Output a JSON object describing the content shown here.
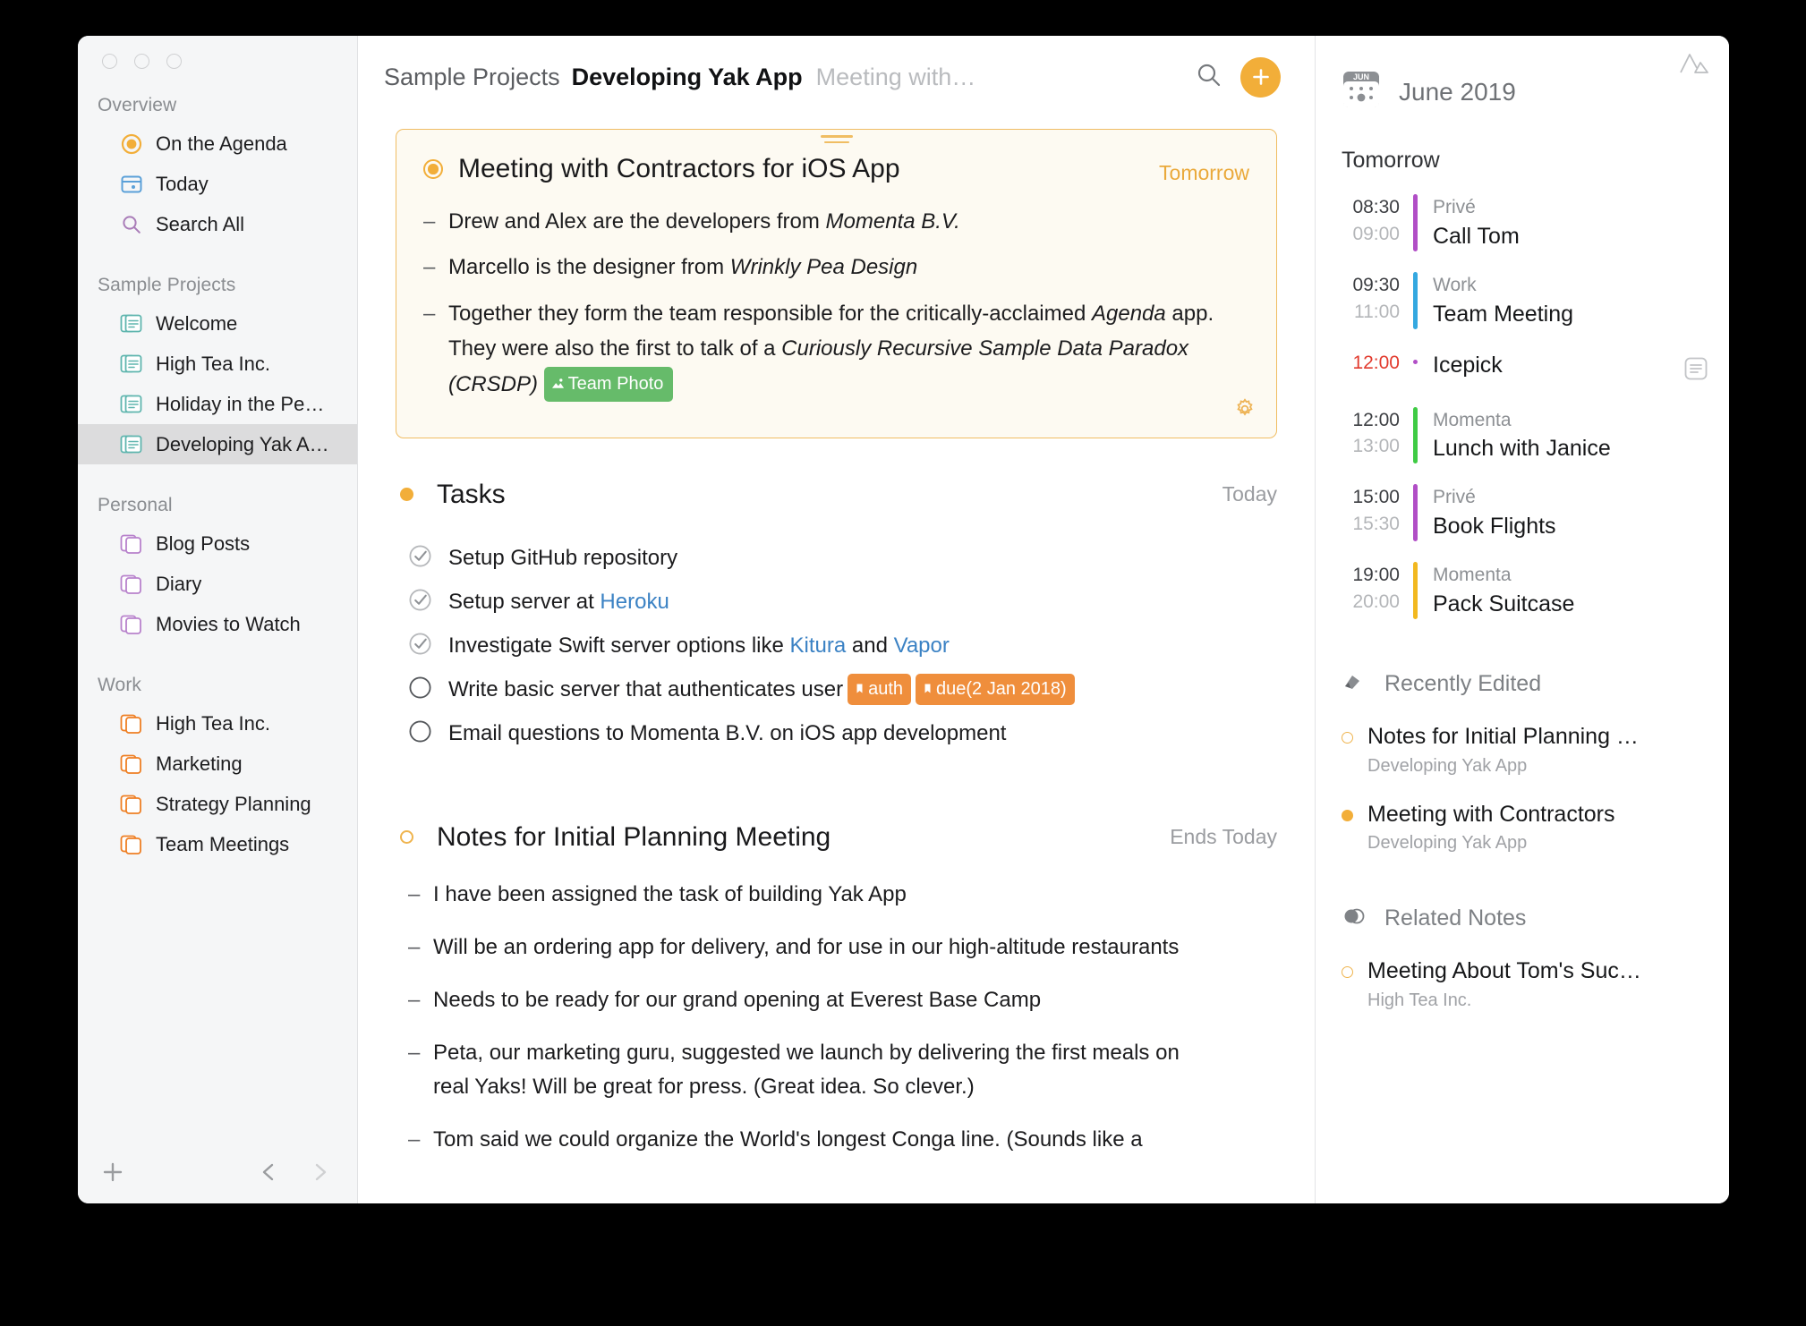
{
  "window": {
    "traffic_lights": [
      "close",
      "minimize",
      "zoom"
    ]
  },
  "sidebar": {
    "groups": [
      {
        "title": "Overview",
        "items": [
          {
            "label": "On the Agenda",
            "icon": "agenda-target-icon",
            "selected": false
          },
          {
            "label": "Today",
            "icon": "today-calendar-icon",
            "selected": false
          },
          {
            "label": "Search All",
            "icon": "search-icon",
            "selected": false
          }
        ]
      },
      {
        "title": "Sample Projects",
        "items": [
          {
            "label": "Welcome",
            "icon": "notes-stack-icon",
            "selected": false
          },
          {
            "label": "High Tea Inc.",
            "icon": "notes-stack-icon",
            "selected": false
          },
          {
            "label": "Holiday in the Pe…",
            "icon": "notes-stack-icon",
            "selected": false
          },
          {
            "label": "Developing Yak A…",
            "icon": "notes-stack-icon",
            "selected": true
          }
        ]
      },
      {
        "title": "Personal",
        "items": [
          {
            "label": "Blog Posts",
            "icon": "folder-stack-icon",
            "selected": false
          },
          {
            "label": "Diary",
            "icon": "folder-stack-icon",
            "selected": false
          },
          {
            "label": "Movies to Watch",
            "icon": "folder-stack-icon",
            "selected": false
          }
        ]
      },
      {
        "title": "Work",
        "items": [
          {
            "label": "High Tea Inc.",
            "icon": "folder-stack-icon",
            "selected": false
          },
          {
            "label": "Marketing",
            "icon": "folder-stack-icon",
            "selected": false
          },
          {
            "label": "Strategy Planning",
            "icon": "folder-stack-icon",
            "selected": false
          },
          {
            "label": "Team Meetings",
            "icon": "folder-stack-icon",
            "selected": false
          }
        ]
      }
    ],
    "bottom_bar": {
      "add": "add-project-icon",
      "back": "chevron-left-icon",
      "forward": "chevron-right-icon"
    }
  },
  "header": {
    "breadcrumb_project": "Sample Projects",
    "breadcrumb_title": "Developing Yak App",
    "breadcrumb_note": "Meeting with…",
    "search_icon": "search-icon",
    "add_icon": "plus-icon"
  },
  "note_card": {
    "title": "Meeting with Contractors for iOS App",
    "when": "Tomorrow",
    "bullets": [
      {
        "parts": [
          {
            "t": "Drew and Alex are the developers from "
          },
          {
            "t": "Momenta B.V.",
            "i": true
          }
        ]
      },
      {
        "parts": [
          {
            "t": "Marcello is the designer from "
          },
          {
            "t": "Wrinkly Pea Design",
            "i": true
          }
        ]
      },
      {
        "parts": [
          {
            "t": "Together they form the team responsible for the critically-acclaimed "
          },
          {
            "t": "Agenda",
            "i": true
          },
          {
            "t": " app. They were also the first to talk of a "
          },
          {
            "t": "Curiously Recursive Sample Data Paradox (CRSDP)",
            "i": true
          },
          {
            "t": " ",
            "tag": false
          }
        ],
        "tag": "Team Photo"
      }
    ],
    "gear_icon": "gear-icon",
    "handle_icon": "drag-handle-icon"
  },
  "tasks_section": {
    "title": "Tasks",
    "when": "Today",
    "items": [
      {
        "done": true,
        "parts": [
          {
            "t": "Setup GitHub repository"
          }
        ]
      },
      {
        "done": true,
        "parts": [
          {
            "t": "Setup server at "
          },
          {
            "t": "Heroku",
            "link": true
          }
        ]
      },
      {
        "done": true,
        "parts": [
          {
            "t": "Investigate Swift server options like "
          },
          {
            "t": "Kitura",
            "link": true
          },
          {
            "t": " and "
          },
          {
            "t": "Vapor",
            "link": true
          }
        ]
      },
      {
        "done": false,
        "parts": [
          {
            "t": "Write basic server that authenticates user"
          }
        ],
        "tags": [
          "auth",
          "due(2 Jan 2018)"
        ]
      },
      {
        "done": false,
        "parts": [
          {
            "t": "Email questions to Momenta B.V. on iOS app development"
          }
        ]
      }
    ]
  },
  "notes_section": {
    "title": "Notes for Initial Planning Meeting",
    "when": "Ends Today",
    "bullets": [
      "I have been assigned the task of building Yak App",
      "Will be an ordering app for delivery, and for use in our high-altitude restaurants",
      "Needs to be ready for our grand opening at Everest Base Camp",
      "Peta, our marketing guru, suggested we launch by delivering the first meals on real Yaks! Will be great for press. (Great idea. So clever.)",
      "Tom said we could organize the World's longest Conga line. (Sounds like a"
    ]
  },
  "right_panel": {
    "mountain_icon": "mountain-icon",
    "calendar_badge": "JUN",
    "calendar_title": "June 2019",
    "day_label": "Tomorrow",
    "events": [
      {
        "start": "08:30",
        "end": "09:00",
        "calendar": "Privé",
        "name": "Call Tom",
        "color": "#b14ec6",
        "style": "bar"
      },
      {
        "start": "09:30",
        "end": "11:00",
        "calendar": "Work",
        "name": "Team Meeting",
        "color": "#34a8e0",
        "style": "bar"
      },
      {
        "start": "12:00",
        "end": "",
        "calendar": "",
        "name": "Icepick",
        "color": "#b14ec6",
        "style": "dot",
        "start_red": true,
        "note_icon": "note-icon"
      },
      {
        "start": "12:00",
        "end": "13:00",
        "calendar": "Momenta",
        "name": "Lunch with Janice",
        "color": "#3fcb44",
        "style": "bar"
      },
      {
        "start": "15:00",
        "end": "15:30",
        "calendar": "Privé",
        "name": "Book Flights",
        "color": "#b14ec6",
        "style": "bar"
      },
      {
        "start": "19:00",
        "end": "20:00",
        "calendar": "Momenta",
        "name": "Pack Suitcase",
        "color": "#f2b81f",
        "style": "bar"
      }
    ],
    "recently_edited": {
      "title": "Recently Edited",
      "icon": "pencil-icon",
      "items": [
        {
          "title": "Notes for Initial Planning …",
          "project": "Developing Yak App",
          "bullet": "hollow"
        },
        {
          "title": "Meeting with Contractors",
          "project": "Developing Yak App",
          "bullet": "filled"
        }
      ]
    },
    "related_notes": {
      "title": "Related Notes",
      "icon": "venn-icon",
      "items": [
        {
          "title": "Meeting About Tom's Suc…",
          "project": "High Tea Inc.",
          "bullet": "hollow"
        }
      ]
    }
  }
}
